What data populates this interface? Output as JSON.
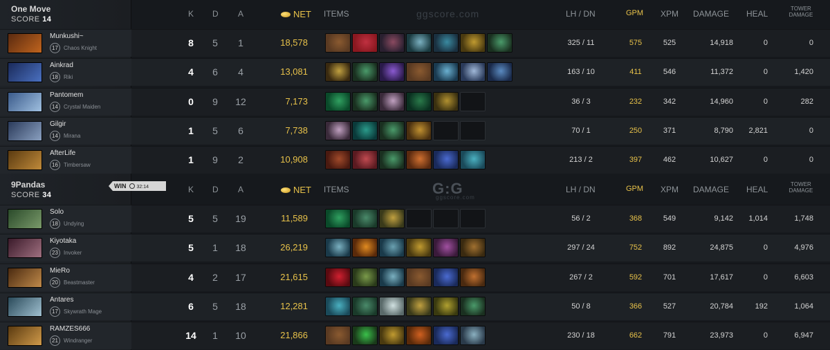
{
  "teams": [
    {
      "name": "One Move",
      "score_label": "SCORE",
      "score": "14",
      "players": [
        {
          "name": "Munkushi~",
          "level": "17",
          "hero": "Chaos Knight",
          "k": "8",
          "d": "5",
          "a": "1",
          "net": "18,578",
          "lhdn": "325 / 11",
          "gpm": "575",
          "xpm": "525",
          "damage": "14,918",
          "heal": "0",
          "tower": "0",
          "portrait": [
            "#5a2a10",
            "#c0641e"
          ],
          "items": [
            [
              "#5a3a22",
              "#8a5a30"
            ],
            [
              "#8a1820",
              "#c03040"
            ],
            [
              "#2a2030",
              "#8a4a60"
            ],
            [
              "#1a3a40",
              "#7ab0c0"
            ],
            [
              "#1a3040",
              "#3a8aa0"
            ],
            [
              "#4a3a10",
              "#c09a30"
            ],
            [
              "#1a3020",
              "#4a9a6a"
            ]
          ]
        },
        {
          "name": "Ainkrad",
          "level": "18",
          "hero": "Riki",
          "k": "4",
          "d": "6",
          "a": "4",
          "net": "13,081",
          "lhdn": "163 / 10",
          "gpm": "411",
          "xpm": "546",
          "damage": "11,372",
          "heal": "0",
          "tower": "1,420",
          "portrait": [
            "#1a2a5a",
            "#4a70c0"
          ],
          "items": [
            [
              "#3a2a10",
              "#c0a040"
            ],
            [
              "#1a3020",
              "#4a9a6a"
            ],
            [
              "#2a1a4a",
              "#8a5ad0"
            ],
            [
              "#5a3a22",
              "#8a5a30"
            ],
            [
              "#1a3a50",
              "#6ab0d0"
            ],
            [
              "#2a3a5a",
              "#a0b8d8"
            ],
            [
              "#1a2a4a",
              "#5a8ac0"
            ]
          ]
        },
        {
          "name": "Pantomem",
          "level": "14",
          "hero": "Crystal Maiden",
          "k": "0",
          "d": "9",
          "a": "12",
          "net": "7,173",
          "lhdn": "36 / 3",
          "gpm": "232",
          "xpm": "342",
          "damage": "14,960",
          "heal": "0",
          "tower": "282",
          "portrait": [
            "#3a5a8a",
            "#a0c0e0"
          ],
          "items": [
            [
              "#0a4a2a",
              "#30a060"
            ],
            [
              "#1a3020",
              "#4a9a6a"
            ],
            [
              "#3a2a3a",
              "#c0a0c0"
            ],
            [
              "#0a3020",
              "#2a7a4a"
            ],
            [
              "#3a3010",
              "#b09030"
            ],
            [
              "empty"
            ]
          ]
        },
        {
          "name": "Gilgir",
          "level": "14",
          "hero": "Mirana",
          "k": "1",
          "d": "5",
          "a": "6",
          "net": "7,738",
          "lhdn": "70 / 1",
          "gpm": "250",
          "xpm": "371",
          "damage": "8,790",
          "heal": "2,821",
          "tower": "0",
          "portrait": [
            "#2a3a5a",
            "#8aa0c0"
          ],
          "items": [
            [
              "#3a2a3a",
              "#c0a0c0"
            ],
            [
              "#0a3a3a",
              "#2a9a8a"
            ],
            [
              "#1a3020",
              "#4a9a6a"
            ],
            [
              "#4a3010",
              "#c09030"
            ],
            [
              "empty"
            ],
            [
              "empty"
            ]
          ]
        },
        {
          "name": "AfterLife",
          "level": "16",
          "hero": "Timbersaw",
          "k": "1",
          "d": "9",
          "a": "2",
          "net": "10,908",
          "lhdn": "213 / 2",
          "gpm": "397",
          "xpm": "462",
          "damage": "10,627",
          "heal": "0",
          "tower": "0",
          "portrait": [
            "#5a3a10",
            "#c08a3a"
          ],
          "items": [
            [
              "#4a1a10",
              "#a04a2a"
            ],
            [
              "#5a1a20",
              "#c04a50"
            ],
            [
              "#1a3020",
              "#4a9a6a"
            ],
            [
              "#5a2a10",
              "#d07030"
            ],
            [
              "#1a2a5a",
              "#4a6ad0"
            ],
            [
              "#1a4a5a",
              "#4ab0c0"
            ]
          ]
        }
      ]
    },
    {
      "name": "9Pandas",
      "score_label": "SCORE",
      "score": "34",
      "players": [
        {
          "name": "Solo",
          "level": "18",
          "hero": "Undying",
          "k": "5",
          "d": "5",
          "a": "19",
          "net": "11,589",
          "lhdn": "56 / 2",
          "gpm": "368",
          "xpm": "549",
          "damage": "9,142",
          "heal": "1,014",
          "tower": "1,748",
          "portrait": [
            "#2a4a2a",
            "#7a9a6a"
          ],
          "items": [
            [
              "#0a4a2a",
              "#30a060"
            ],
            [
              "#1a3a2a",
              "#4a8a6a"
            ],
            [
              "#3a3a1a",
              "#c0a040"
            ],
            [
              "empty"
            ],
            [
              "empty"
            ],
            [
              "empty"
            ]
          ]
        },
        {
          "name": "Kiyotaka",
          "level": "23",
          "hero": "Invoker",
          "k": "5",
          "d": "1",
          "a": "18",
          "net": "26,219",
          "lhdn": "297 / 24",
          "gpm": "752",
          "xpm": "892",
          "damage": "24,875",
          "heal": "0",
          "tower": "4,976",
          "portrait": [
            "#3a1a2a",
            "#a07080"
          ],
          "items": [
            [
              "#1a3a4a",
              "#7ab0c0"
            ],
            [
              "#5a2a0a",
              "#e08a20"
            ],
            [
              "#1a3a4a",
              "#6aa0b0"
            ],
            [
              "#4a3a10",
              "#c09a30"
            ],
            [
              "#3a1a3a",
              "#a050a0"
            ],
            [
              "#3a2a10",
              "#a07030"
            ]
          ]
        },
        {
          "name": "MieRo",
          "level": "20",
          "hero": "Beastmaster",
          "k": "4",
          "d": "2",
          "a": "17",
          "net": "21,615",
          "lhdn": "267 / 2",
          "gpm": "592",
          "xpm": "701",
          "damage": "17,617",
          "heal": "0",
          "tower": "6,603",
          "portrait": [
            "#4a2a10",
            "#c08a4a"
          ],
          "items": [
            [
              "#5a0a10",
              "#d02030"
            ],
            [
              "#2a3a1a",
              "#7a9a4a"
            ],
            [
              "#1a3a4a",
              "#7ab0c0"
            ],
            [
              "#5a3a22",
              "#8a5a30"
            ],
            [
              "#1a2a5a",
              "#4a6ad0"
            ],
            [
              "#4a2a10",
              "#c07030"
            ]
          ]
        },
        {
          "name": "Antares",
          "level": "17",
          "hero": "Skywrath Mage",
          "k": "6",
          "d": "5",
          "a": "18",
          "net": "12,281",
          "lhdn": "50 / 8",
          "gpm": "366",
          "xpm": "527",
          "damage": "20,784",
          "heal": "192",
          "tower": "1,064",
          "portrait": [
            "#2a4a5a",
            "#a0c0d0"
          ],
          "items": [
            [
              "#1a4a5a",
              "#4ab0c0"
            ],
            [
              "#1a3a2a",
              "#4a8a6a"
            ],
            [
              "#5a6a6a",
              "#d0e0e0"
            ],
            [
              "#3a3a1a",
              "#c0a040"
            ],
            [
              "#3a3a10",
              "#b0a030"
            ],
            [
              "#1a3020",
              "#4a9a6a"
            ]
          ]
        },
        {
          "name": "RAMZES666",
          "level": "21",
          "hero": "Windranger",
          "k": "14",
          "d": "1",
          "a": "10",
          "net": "21,866",
          "lhdn": "230 / 18",
          "gpm": "662",
          "xpm": "791",
          "damage": "23,973",
          "heal": "0",
          "tower": "6,947",
          "portrait": [
            "#5a3a10",
            "#d09a4a"
          ],
          "items": [
            [
              "#5a3a22",
              "#8a5a30"
            ],
            [
              "#1a3a1a",
              "#3ac04a"
            ],
            [
              "#4a3a10",
              "#c09a30"
            ],
            [
              "#5a2a0a",
              "#d06020"
            ],
            [
              "#1a2a5a",
              "#4a6ad0"
            ],
            [
              "#2a3a4a",
              "#8ab0c0"
            ]
          ]
        }
      ]
    }
  ],
  "headers": {
    "k": "K",
    "d": "D",
    "a": "A",
    "net": "NET",
    "items": "ITEMS",
    "lhdn": "LH  /  DN",
    "gpm": "GPM",
    "xpm": "XPM",
    "damage": "DAMAGE",
    "heal": "HEAL",
    "tower_line1": "TOWER",
    "tower_line2": "DAMAGE"
  },
  "watermarks": {
    "top": "ggscore.com",
    "bottom_logo": "G:G",
    "bottom_sub": "ggscore.com"
  },
  "result": {
    "label": "WIN",
    "time": "32:14"
  },
  "colors": {
    "accent_gold": "#e8c24a",
    "background": "#16191d"
  }
}
